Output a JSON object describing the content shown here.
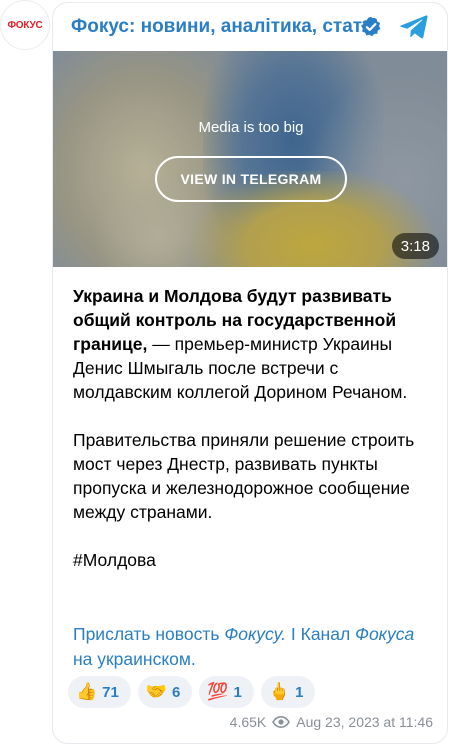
{
  "channel": {
    "avatar_text": "ФОКУС",
    "title": "Фокус: новини, аналітика, статті"
  },
  "media": {
    "note": "Media is too big",
    "button_label": "VIEW IN TELEGRAM",
    "duration": "3:18"
  },
  "post": {
    "bold_lead": "Украина и Молдова будут развивать общий контроль на государственной границе,",
    "lead_rest": " — премьер-министр Украины Денис Шмыгаль после встречи с молдавским коллегой Дорином Речаном.",
    "paragraph2": "Правительства приняли решение строить мост через Днестр, развивать пункты пропуска и железнодорожное сообщение между странами.",
    "hashtag": "#Молдова"
  },
  "links": {
    "send_news_prefix": "Прислать новость ",
    "send_news_italic": "Фокусу.",
    "separator": " I ",
    "channel_prefix": "Канал ",
    "channel_italic": "Фокуса",
    "channel_suffix": " на украинском."
  },
  "reactions": [
    {
      "emoji": "👍",
      "count": "71"
    },
    {
      "emoji": "🤝",
      "count": "6"
    },
    {
      "emoji": "💯",
      "count": "1"
    },
    {
      "emoji": "🖕",
      "count": "1"
    }
  ],
  "meta": {
    "views": "4.65K",
    "date": "Aug 23, 2023 at 11:46"
  },
  "colors": {
    "accent": "#2a7fc4",
    "avatar_red": "#e0202a",
    "verified_blue": "#2a7fc4",
    "meta_gray": "#8a9097"
  }
}
